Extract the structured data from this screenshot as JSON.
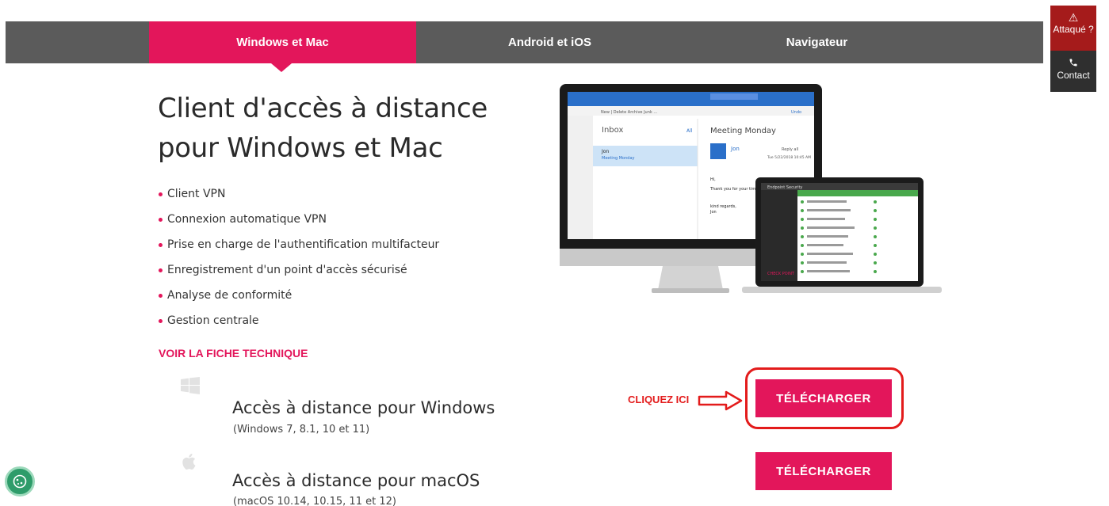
{
  "tabs": [
    {
      "label": "Windows et Mac",
      "active": true
    },
    {
      "label": "Android et iOS",
      "active": false
    },
    {
      "label": "Navigateur",
      "active": false
    }
  ],
  "side": {
    "attack_label": "Attaqué ?",
    "contact_label": "Contact",
    "attack_icon": "warning-icon",
    "contact_icon": "phone-icon"
  },
  "heading": "Client d'accès à distance pour Windows et Mac",
  "features": [
    "Client VPN",
    "Connexion automatique VPN",
    "Prise en charge de l'authentification multifacteur",
    "Enregistrement d'un point d'accès sécurisé",
    "Analyse de conformité",
    "Gestion centrale"
  ],
  "spec_link": "VOIR LA FICHE TECHNIQUE",
  "downloads": [
    {
      "icon": "windows-logo-icon",
      "name": "Accès à distance pour Windows",
      "versions": "(Windows 7, 8.1, 10 et 11)",
      "button": "TÉLÉCHARGER"
    },
    {
      "icon": "apple-logo-icon",
      "name": "Accès à distance pour macOS",
      "versions": "(macOS 10.14, 10.15, 11 et 12)",
      "button": "TÉLÉCHARGER"
    }
  ],
  "annotation": "CLIQUEZ ICI",
  "screen_mockup": {
    "inbox": "Inbox",
    "all": "All",
    "meeting": "Meeting Monday",
    "sender": "Jon",
    "reply": "Reply all",
    "date": "Tue 5/22/2018 10:45 AM",
    "toolbar": "New  |  Delete  Archive  Junk  ...",
    "undo": "Undo",
    "hi": "Hi,",
    "body": "Thank you for your time Monday.",
    "sign": "kind regards,",
    "sign_name": "Jon",
    "app_title": "Endpoint Security",
    "brand": "CHECK POINT"
  },
  "colors": {
    "accent": "#e3165b",
    "tabbar": "#5b5b5b",
    "alert": "#a51b1b",
    "annotation": "#e31b1b"
  }
}
